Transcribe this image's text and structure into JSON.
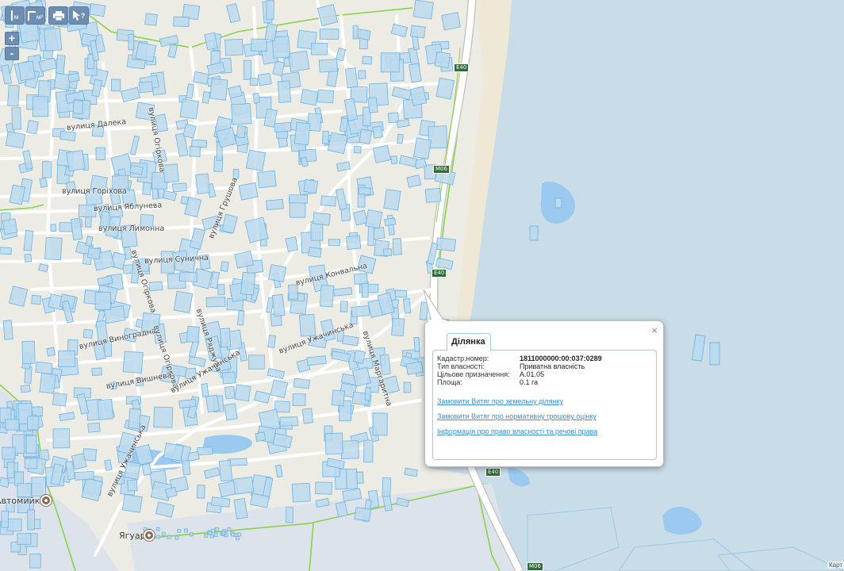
{
  "toolbar": {
    "ruler_label": "м",
    "area_label": "м²",
    "print_icon": "print-icon",
    "info_icon": "cursor-help-icon",
    "info_label": "?"
  },
  "zoom": {
    "in_label": "+",
    "out_label": "-"
  },
  "streets": {
    "dalekа": "вулиця Далека",
    "horikhova": "вулиця Горіхова",
    "yablunevа": "вулиця Яблунева",
    "lymonna": "вулиця Лимонна",
    "ogirkova_north": "вулиця Огіркова",
    "hrushova": "вулиця Грушова",
    "sunychna": "вулиця Сунична",
    "ogirkova_mid": "вулиця Огіркова",
    "konvalna": "вулиця Конвальна",
    "vynohradna": "вулиця Виноградна",
    "ogirkova_south": "вулиця Огіркова",
    "rodzhova": "вулиця Ряджуна",
    "uzhachynska_east": "вулиця Ужачинська",
    "marharytna": "вулиця Маргаритна",
    "vyshneva": "вулиця Вишнева",
    "uzhachynska_mid": "вулиця Ужачинська",
    "uzhachynska_south": "вулиця Ужачинська"
  },
  "roads": {
    "e40": "E40",
    "m06": "M06"
  },
  "pois": {
    "car_wash": "Автомийка",
    "jaguar": "Ягуар"
  },
  "popup": {
    "tab": "Ділянка",
    "close": "×",
    "rows": [
      {
        "key": "Кадастр.номер:",
        "value": "1811000000:00:037:0289"
      },
      {
        "key": "Тип власності:",
        "value": "Приватна власність"
      },
      {
        "key": "Цільове призначення:",
        "value": "A.01.05"
      },
      {
        "key": "Площа:",
        "value": "0.1 га"
      }
    ],
    "links": [
      "Замовити Витяг про земельну ділянку",
      "Замовити Витяг про нормативну грошову оцінку",
      "Інформація про право власності та речові права"
    ]
  },
  "attribution": "Карт",
  "colors": {
    "land": "#ecebe4",
    "water": "#c9dde9",
    "parcel_fill": "#bcdbef",
    "parcel_stroke": "#7ab8e2",
    "boundary": "#8ad24a",
    "button": "#6d8db1"
  }
}
